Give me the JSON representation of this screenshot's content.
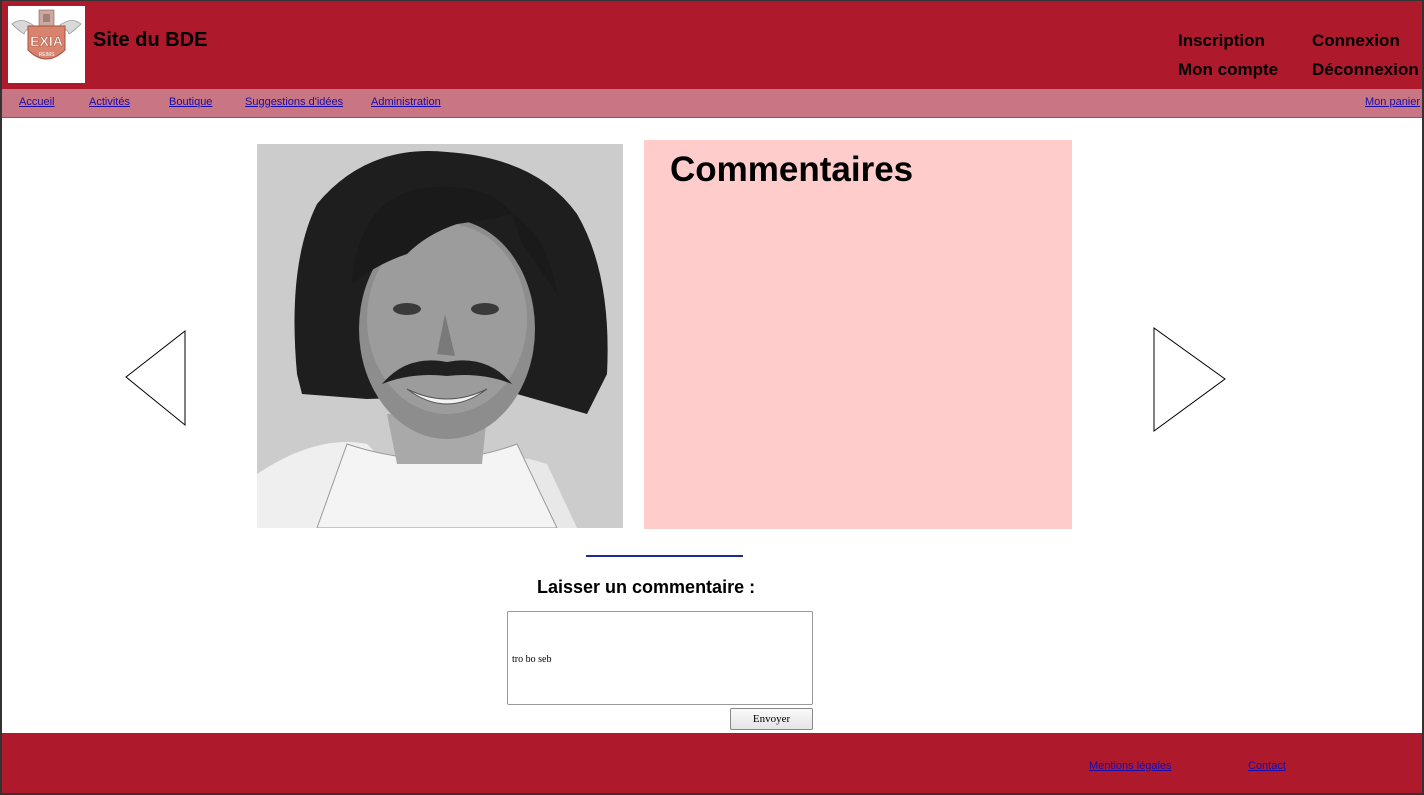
{
  "header": {
    "site_title": "Site du BDE",
    "logo_text": "EXIA",
    "logo_subtext": "REIMS",
    "account_links": {
      "inscription": "Inscription",
      "connexion": "Connexion",
      "mon_compte": "Mon compte",
      "deconnexion": "Déconnexion"
    }
  },
  "nav": {
    "items": [
      "Accueil",
      "Activités",
      "Boutique",
      "Suggestions d'idées",
      "Administration"
    ],
    "cart": "Mon panier"
  },
  "main": {
    "photo_icon": "portrait-photo",
    "comments_title": "Commentaires",
    "leave_comment_label": "Laisser un commentaire :",
    "comment_value": "tro bo seb",
    "send_label": "Envoyer",
    "prev_icon": "left-arrow-icon",
    "next_icon": "right-arrow-icon"
  },
  "footer": {
    "mentions": "Mentions légales",
    "contact": "Contact"
  },
  "colors": {
    "header_bg": "#ae1a2c",
    "nav_bg": "#c87584",
    "comments_bg": "#ffcccc",
    "link": "#1a0dab"
  }
}
